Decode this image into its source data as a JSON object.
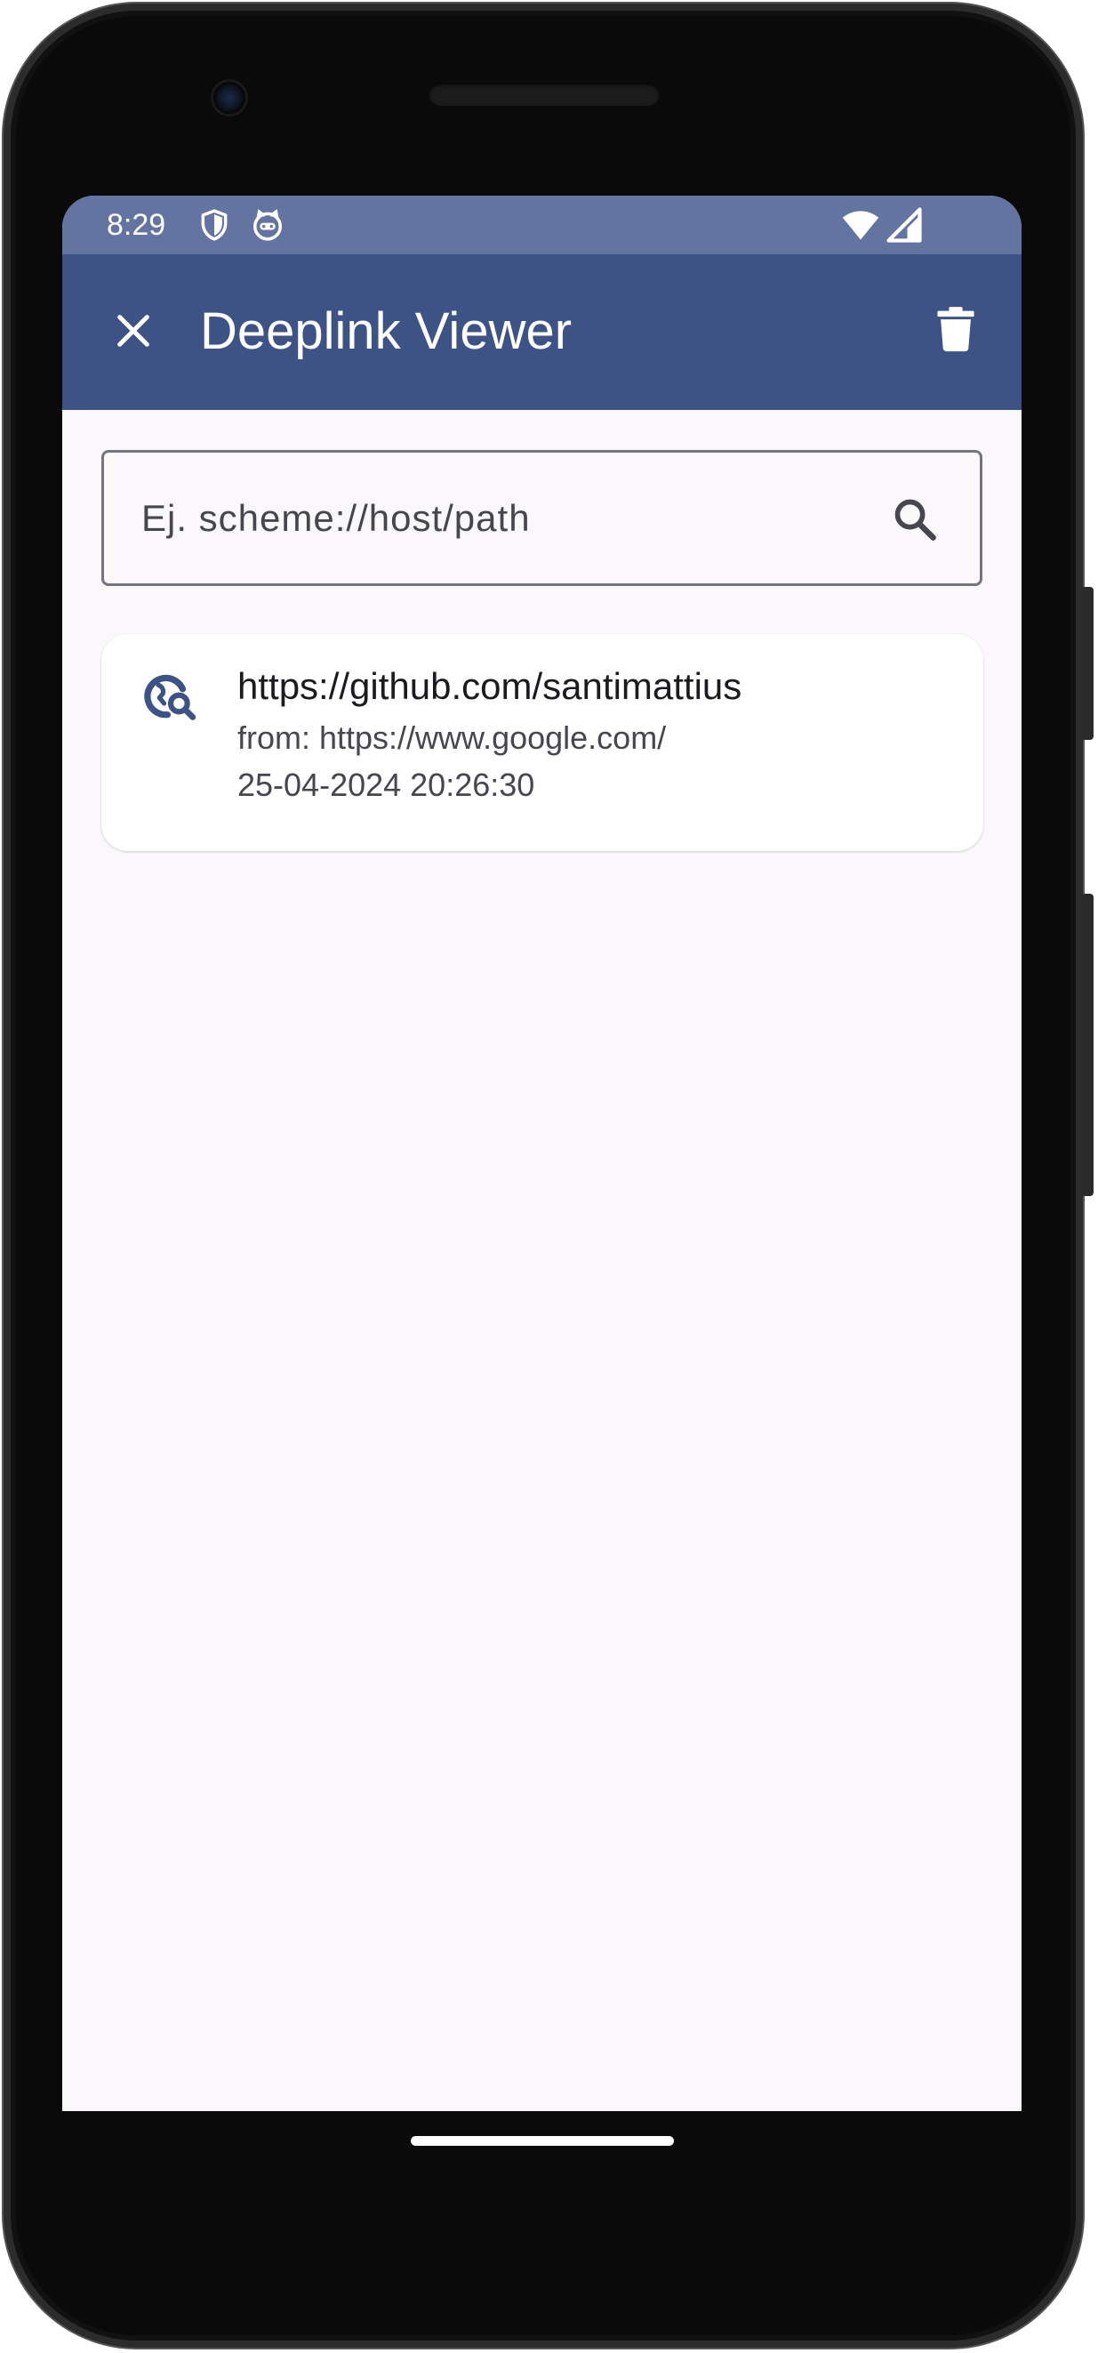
{
  "status_bar": {
    "time": "8:29",
    "icons": [
      "shield-icon",
      "cat-face-icon",
      "wifi-icon",
      "signal-icon"
    ]
  },
  "app_bar": {
    "title": "Deeplink Viewer",
    "close_icon": "close-icon",
    "delete_icon": "trash-icon",
    "background_color": "#3d5285"
  },
  "search": {
    "placeholder": "Ej. scheme://host/path",
    "value": "",
    "icon": "search-icon"
  },
  "history": [
    {
      "url": "https://github.com/santimattius",
      "from": "from: https://www.google.com/",
      "date": "25-04-2024 20:26:30",
      "icon": "travel-explore-icon"
    }
  ],
  "colors": {
    "status_bar": "#6474a0",
    "primary": "#3d5285",
    "background": "#fbf8fc"
  }
}
